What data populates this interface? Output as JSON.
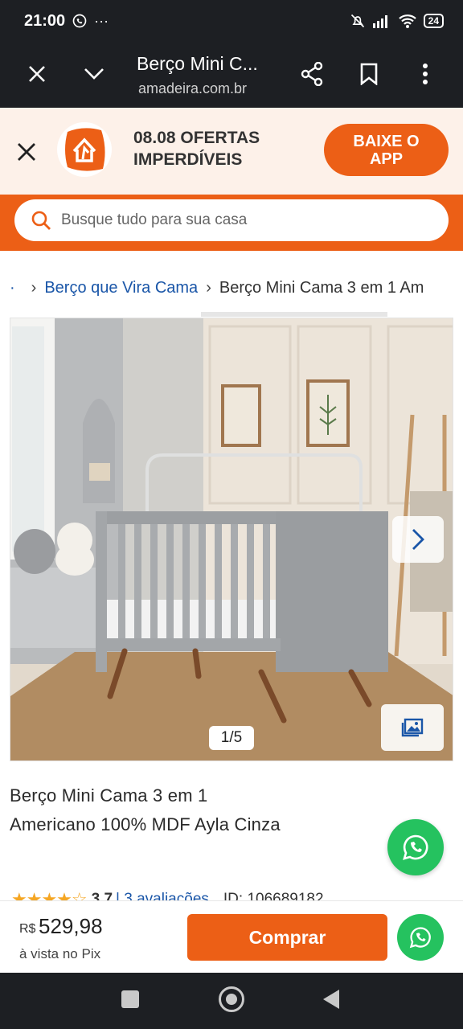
{
  "status_bar": {
    "time": "21:00",
    "dots": "···",
    "battery": "24"
  },
  "browser": {
    "tab_title": "Berço Mini C...",
    "url": "amadeira.com.br"
  },
  "promo": {
    "text_line1": "08.08 OFERTAS",
    "text_line2": "IMPERDÍVEIS",
    "app_button_line1": "BAIXE O",
    "app_button_line2": "APP"
  },
  "search": {
    "placeholder": "Busque tudo para sua casa"
  },
  "breadcrumb": {
    "items": [
      "Berço que Vira Cama",
      "Berço Mini Cama 3 em 1 Am"
    ]
  },
  "gallery": {
    "counter": "1/5"
  },
  "product": {
    "title_line1": "Berço Mini Cama 3 em 1",
    "title_line2": "Americano 100% MDF Ayla Cinza",
    "stars": "★★★★☆",
    "rating": "3.7",
    "reviews": "| 3 avaliações",
    "id": "ID: 106689182"
  },
  "purchase": {
    "currency": "R$",
    "price": "529,98",
    "price_note": "à vista no Pix",
    "buy_label": "Comprar"
  },
  "colors": {
    "brand_orange": "#ec5f16",
    "whatsapp_green": "#25c25f",
    "link_blue": "#1a56a8"
  },
  "icons": [
    "whatsapp-icon",
    "close-icon",
    "chevron-down-icon",
    "share-icon",
    "bookmark-icon",
    "more-vert-icon",
    "search-icon",
    "chevron-right-icon",
    "image-gallery-icon",
    "madeira-logo-icon"
  ]
}
